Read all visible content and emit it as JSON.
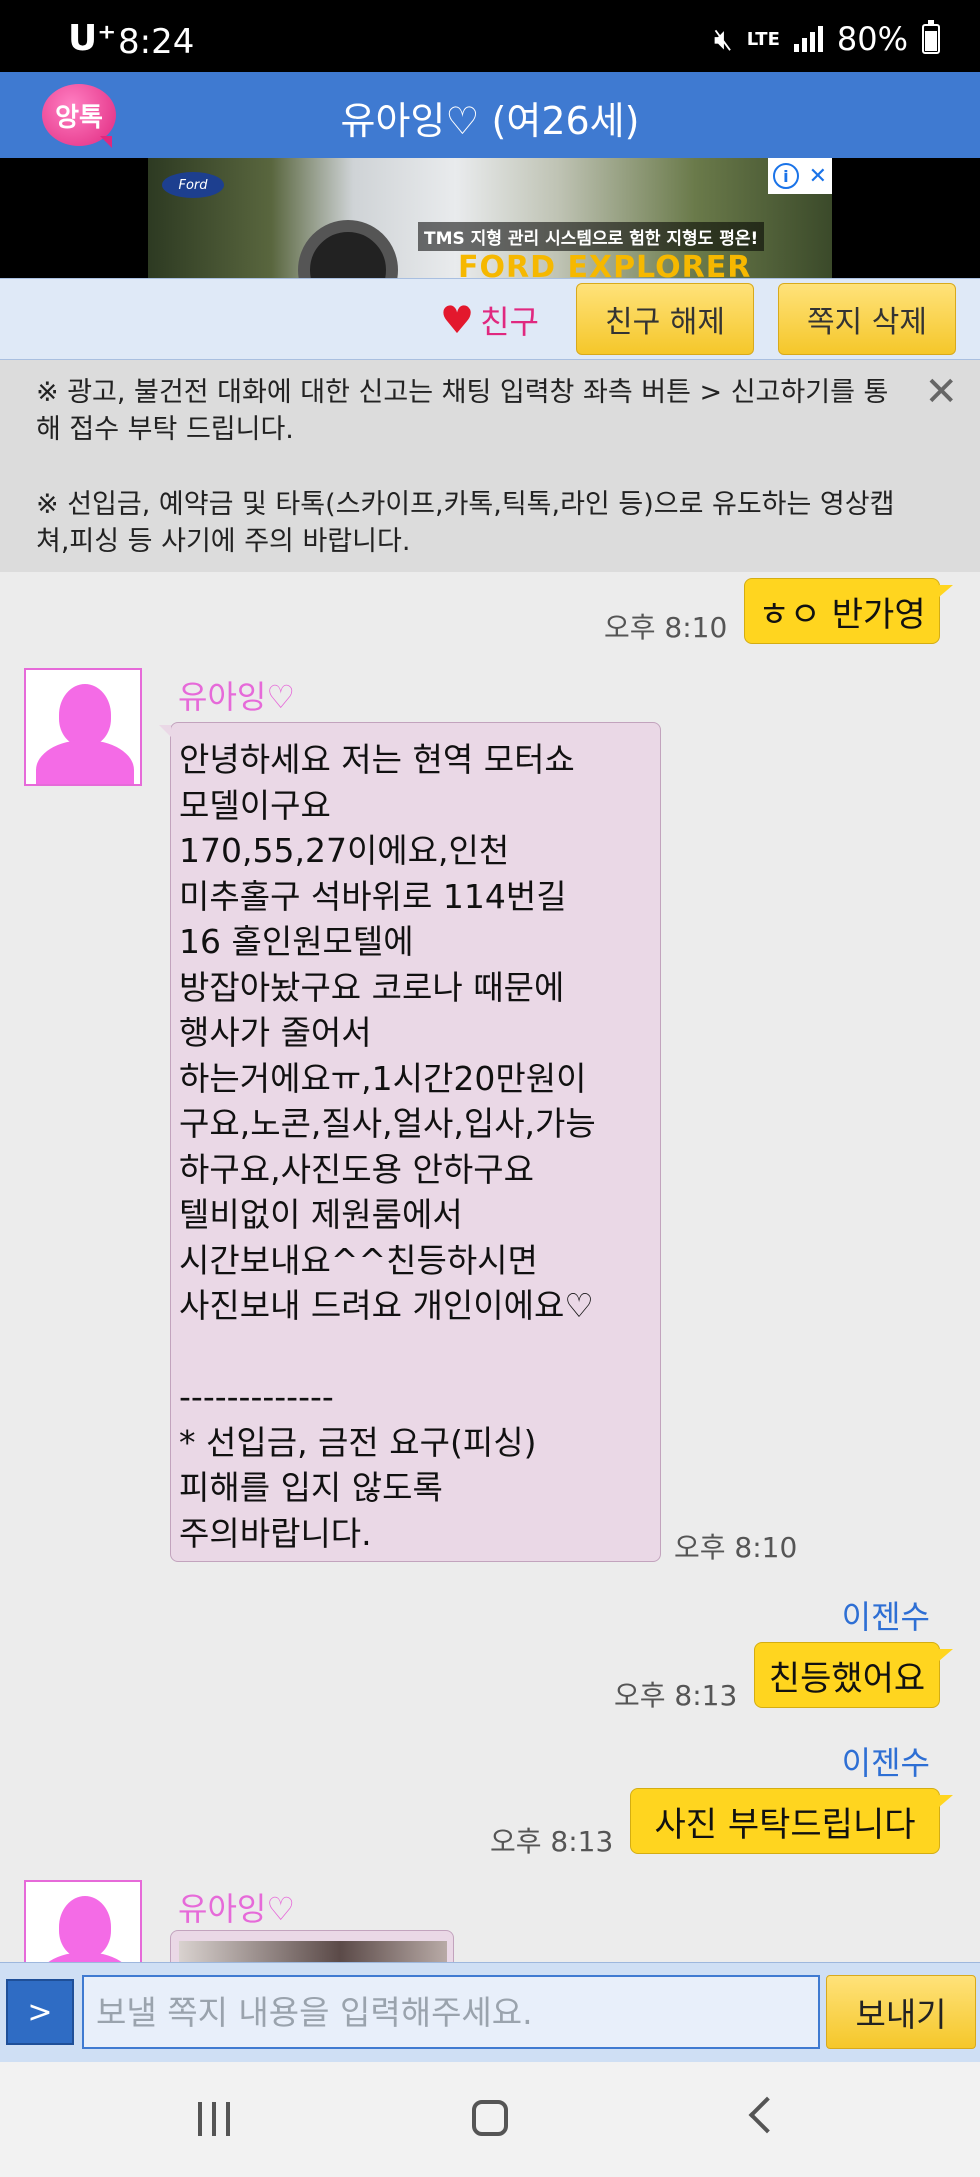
{
  "status": {
    "carrier": "U⁺",
    "time": "8:24",
    "network": "LTE",
    "battery": "80%"
  },
  "header": {
    "logo_text": "앙톡",
    "title": "유아잉♡ (여26세)"
  },
  "ad": {
    "brand": "Ford",
    "headline": "TMS 지형 관리 시스템으로 험한 지형도 평온!",
    "model": "FORD EXPLORER"
  },
  "actions": {
    "friend_label": "친구",
    "unfriend_label": "친구 해제",
    "delete_label": "쪽지 삭제"
  },
  "notice": {
    "line1": "※ 광고, 불건전 대화에 대한 신고는 채팅 입력창 좌측 버튼 > 신고하기를 통해 접수 부탁 드립니다.",
    "line2": "※ 선입금, 예약금 및 타톡(스카이프,카톡,틱톡,라인 등)으로 유도하는 영상캡쳐,피싱 등 사기에 주의 바랍니다."
  },
  "messages": [
    {
      "from": "me",
      "text": "ㅎㅇ 반가영",
      "time": "오후 8:10"
    },
    {
      "from": "유아잉♡",
      "text": "안녕하세요 저는 현역 모터쇼\n모델이구요\n170,55,27이에요,인천\n미추홀구 석바위로 114번길\n16 홀인원모텔에\n방잡아놨구요 코로나 때문에\n행사가 줄어서\n하는거에요ㅠ,1시간20만원이\n구요,노콘,질사,얼사,입사,가능\n하구요,사진도용 안하구요\n텔비없이 제원룸에서\n시간보내요^^친등하시면\n사진보내 드려요 개인이에요♡\n\n-------------\n* 선입금, 금전 요구(피싱)\n피해를 입지 않도록\n주의바랍니다.",
      "time": "오후 8:10"
    },
    {
      "from": "이젠수",
      "text": "친등했어요",
      "time": "오후 8:13"
    },
    {
      "from": "이젠수",
      "text": "사진 부탁드립니다",
      "time": "오후 8:13"
    },
    {
      "from": "유아잉♡"
    }
  ],
  "input": {
    "toggle": ">",
    "placeholder": "보낼 쪽지 내용을 입력해주세요.",
    "send_label": "보내기"
  },
  "colors": {
    "header_blue": "#3f7ad1",
    "bubble_yellow": "#ffd51f",
    "bubble_pink": "#ead8e6",
    "sender_pink": "#e66ad9",
    "sender_blue": "#2e6fd4"
  }
}
